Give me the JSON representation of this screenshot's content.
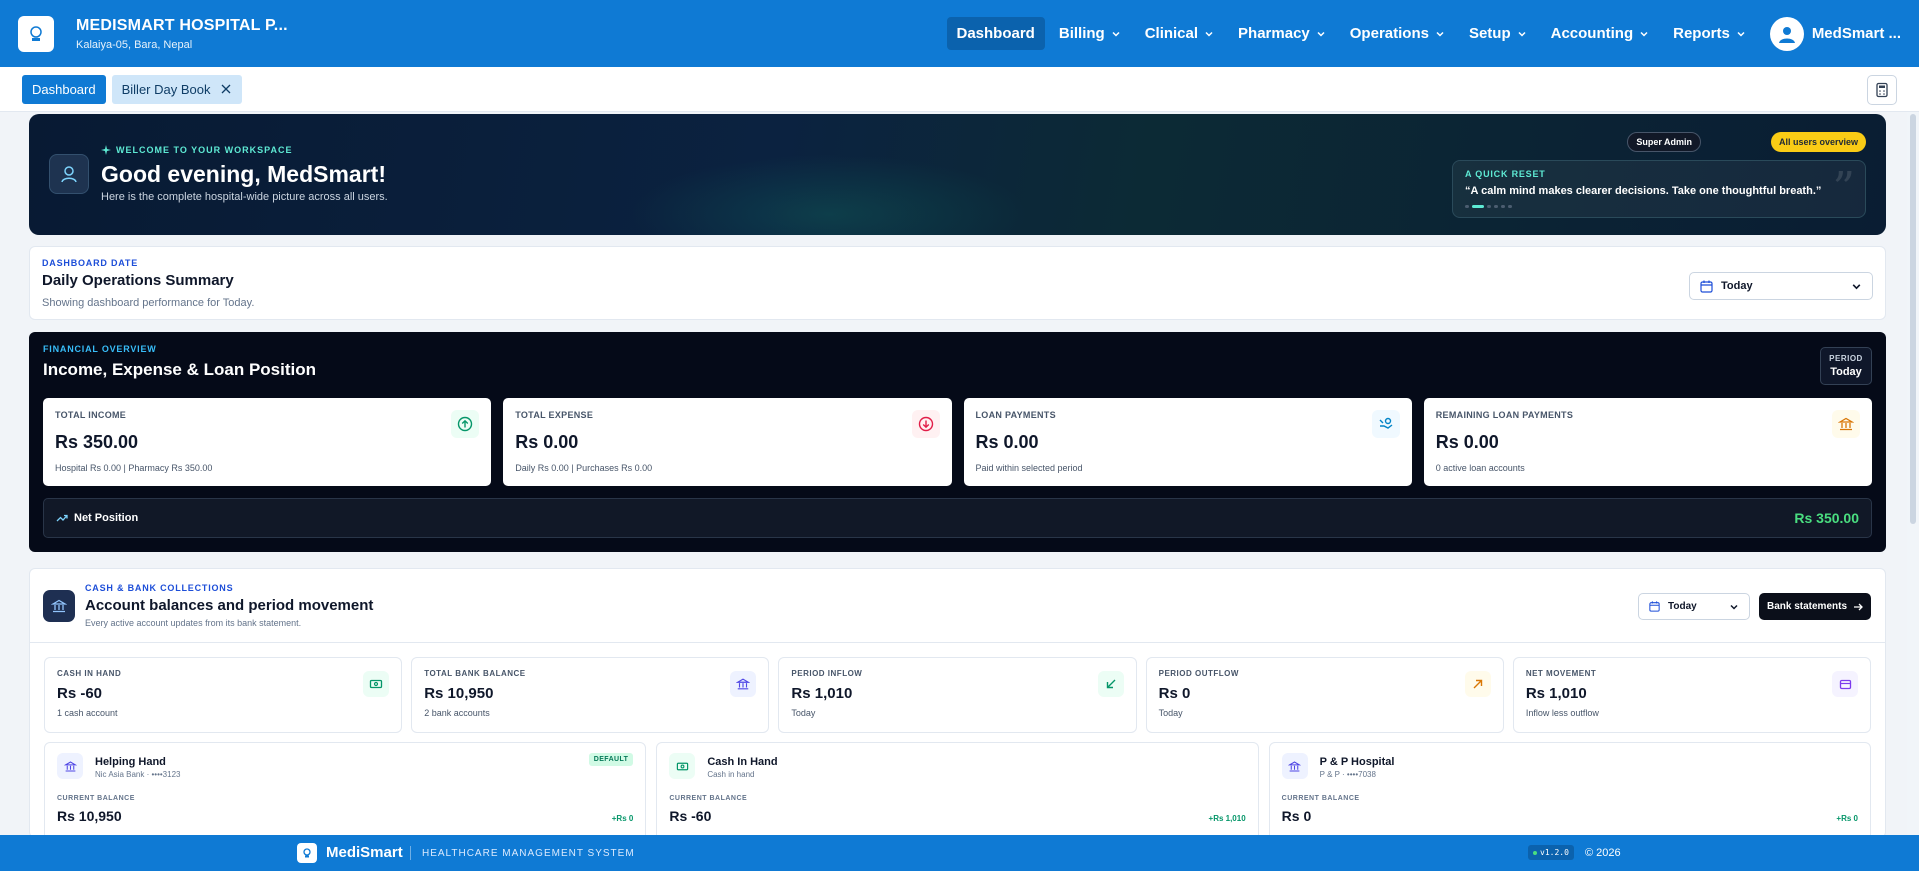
{
  "brand": {
    "name": "MEDISMART HOSPITAL P...",
    "address": "Kalaiya-05, Bara, Nepal"
  },
  "nav": {
    "items": [
      {
        "label": "Dashboard",
        "active": true
      },
      {
        "label": "Billing"
      },
      {
        "label": "Clinical"
      },
      {
        "label": "Pharmacy"
      },
      {
        "label": "Operations"
      },
      {
        "label": "Setup"
      },
      {
        "label": "Accounting"
      },
      {
        "label": "Reports"
      }
    ],
    "user": "MedSmart ..."
  },
  "tabs": {
    "dashboard": "Dashboard",
    "biller": "Biller Day Book"
  },
  "hero": {
    "kicker": "WELCOME TO YOUR WORKSPACE",
    "title": "Good evening, MedSmart!",
    "subtitle": "Here is the complete hospital-wide picture across all users.",
    "badge_role": "Super Admin",
    "badge_scope": "All users overview",
    "quote_kicker": "A QUICK RESET",
    "quote_text": "“A calm mind makes clearer decisions. Take one thoughtful breath.”"
  },
  "date_card": {
    "kicker": "DASHBOARD DATE",
    "title": "Daily Operations Summary",
    "subtitle": "Showing dashboard performance for Today.",
    "select_value": "Today"
  },
  "financial": {
    "kicker": "FINANCIAL OVERVIEW",
    "title": "Income, Expense & Loan Position",
    "period_label": "PERIOD",
    "period_value": "Today",
    "cards": [
      {
        "label": "TOTAL INCOME",
        "value": "Rs 350.00",
        "sub": "Hospital Rs 0.00 | Pharmacy Rs 350.00"
      },
      {
        "label": "TOTAL EXPENSE",
        "value": "Rs 0.00",
        "sub": "Daily Rs 0.00 | Purchases Rs 0.00"
      },
      {
        "label": "LOAN PAYMENTS",
        "value": "Rs 0.00",
        "sub": "Paid within selected period"
      },
      {
        "label": "REMAINING LOAN PAYMENTS",
        "value": "Rs 0.00",
        "sub": "0 active loan accounts"
      }
    ],
    "net_label": "Net Position",
    "net_value": "Rs 350.00",
    "colors": {
      "income": "#059669",
      "expense": "#e11d48",
      "loan": "#0284c7",
      "remaining": "#d97706",
      "net": "#4ade80"
    }
  },
  "cash": {
    "kicker": "CASH & BANK COLLECTIONS",
    "title": "Account balances and period movement",
    "subtitle": "Every active account updates from its bank statement.",
    "select_value": "Today",
    "button": "Bank statements",
    "stats": [
      {
        "label": "CASH IN HAND",
        "value": "Rs -60",
        "sub": "1 cash account"
      },
      {
        "label": "TOTAL BANK BALANCE",
        "value": "Rs 10,950",
        "sub": "2 bank accounts"
      },
      {
        "label": "PERIOD INFLOW",
        "value": "Rs 1,010",
        "sub": "Today"
      },
      {
        "label": "PERIOD OUTFLOW",
        "value": "Rs 0",
        "sub": "Today"
      },
      {
        "label": "NET MOVEMENT",
        "value": "Rs 1,010",
        "sub": "Inflow less outflow"
      }
    ],
    "accounts": [
      {
        "name": "Helping Hand",
        "detail": "Nic Asia Bank · ••••3123",
        "badge": "DEFAULT",
        "balance_label": "CURRENT BALANCE",
        "balance": "Rs 10,950",
        "change": "+Rs 0"
      },
      {
        "name": "Cash In Hand",
        "detail": "Cash in hand",
        "balance_label": "CURRENT BALANCE",
        "balance": "Rs -60",
        "change": "+Rs 1,010"
      },
      {
        "name": "P & P Hospital",
        "detail": "P & P · ••••7038",
        "balance_label": "CURRENT BALANCE",
        "balance": "Rs 0",
        "change": "+Rs 0"
      }
    ]
  },
  "footer": {
    "name": "MediSmart",
    "tagline": "HEALTHCARE MANAGEMENT SYSTEM",
    "version": "v1.2.0",
    "copyright": "© 2026"
  },
  "accent": "#0f7ad4"
}
